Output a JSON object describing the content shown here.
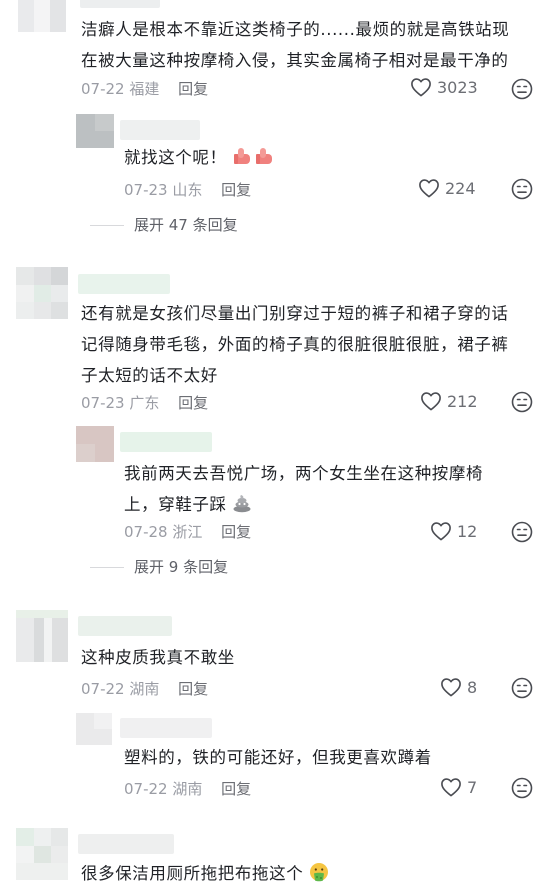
{
  "comments": [
    {
      "text_lines": [
        "洁癖人是根本不靠近这类椅子的......最烦的就是高铁站现",
        "在被大量这种按摩椅入侵，其实金属椅子相对是最干净的"
      ],
      "date": "07-22",
      "location": "福建",
      "reply_label": "回复",
      "likes": "3023",
      "replies": [
        {
          "text_lines": [
            "就找这个呢！"
          ],
          "date": "07-23",
          "location": "山东",
          "reply_label": "回复",
          "likes": "224"
        }
      ],
      "expand_label": "展开 47 条回复"
    },
    {
      "text_lines": [
        "还有就是女孩们尽量出门别穿过于短的裤子和裙子穿的话",
        "记得随身带毛毯，外面的椅子真的很脏很脏很脏，裙子裤",
        "子太短的话不太好"
      ],
      "date": "07-23",
      "location": "广东",
      "reply_label": "回复",
      "likes": "212",
      "replies": [
        {
          "text_lines": [
            "我前两天去吾悦广场，两个女生坐在这种按摩椅",
            "上，穿鞋子踩"
          ],
          "date": "07-28",
          "location": "浙江",
          "reply_label": "回复",
          "likes": "12"
        }
      ],
      "expand_label": "展开 9 条回复"
    },
    {
      "text_lines": [
        "这种皮质我真不敢坐"
      ],
      "date": "07-22",
      "location": "湖南",
      "reply_label": "回复",
      "likes": "8",
      "replies": [
        {
          "text_lines": [
            "塑料的，铁的可能还好，但我更喜欢蹲着"
          ],
          "date": "07-22",
          "location": "湖南",
          "reply_label": "回复",
          "likes": "7"
        }
      ]
    },
    {
      "text_lines": [
        "很多保洁用厕所拖把布拖这个"
      ]
    }
  ],
  "icons": {
    "heart": "heart-outline-icon",
    "dislike": "dislike-face-icon",
    "emoji_thumbs": "thumbs-up-emoji-icon",
    "emoji_poop": "poop-emoji-icon",
    "emoji_vomit": "vomiting-face-emoji-icon"
  },
  "colors": {
    "text": "#1f2126",
    "meta": "#9a9ca4",
    "action": "#6c6e74"
  }
}
